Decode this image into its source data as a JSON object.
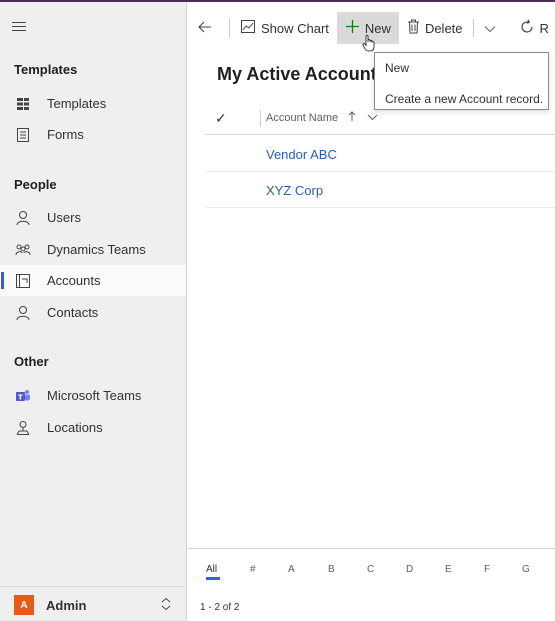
{
  "sidebar": {
    "groups": {
      "templates": "Templates",
      "people": "People",
      "other": "Other"
    },
    "items": [
      {
        "label": "Templates",
        "icon": "templates-icon"
      },
      {
        "label": "Forms",
        "icon": "forms-icon"
      },
      {
        "label": "Users",
        "icon": "user-icon"
      },
      {
        "label": "Dynamics Teams",
        "icon": "teams-icon"
      },
      {
        "label": "Accounts",
        "icon": "accounts-icon"
      },
      {
        "label": "Contacts",
        "icon": "contact-icon"
      },
      {
        "label": "Microsoft Teams",
        "icon": "microsoft-teams-icon"
      },
      {
        "label": "Locations",
        "icon": "location-icon"
      }
    ],
    "footer": {
      "avatar": "A",
      "label": "Admin"
    }
  },
  "toolbar": {
    "show_chart": "Show Chart",
    "new": "New",
    "delete": "Delete",
    "refresh": "R"
  },
  "view": {
    "title": "My Active Accounts"
  },
  "tooltip": {
    "title": "New",
    "description": "Create a new Account record."
  },
  "grid": {
    "column": "Account Name",
    "rows": [
      "Vendor ABC",
      "XYZ Corp"
    ]
  },
  "alphabet": [
    "All",
    "#",
    "A",
    "B",
    "C",
    "D",
    "E",
    "F",
    "G"
  ],
  "status": "1 - 2 of 2",
  "colors": {
    "accent": "#2266e3",
    "avatar": "#e55b17",
    "link": "#2a5ea7",
    "new_plus": "#107c10"
  }
}
